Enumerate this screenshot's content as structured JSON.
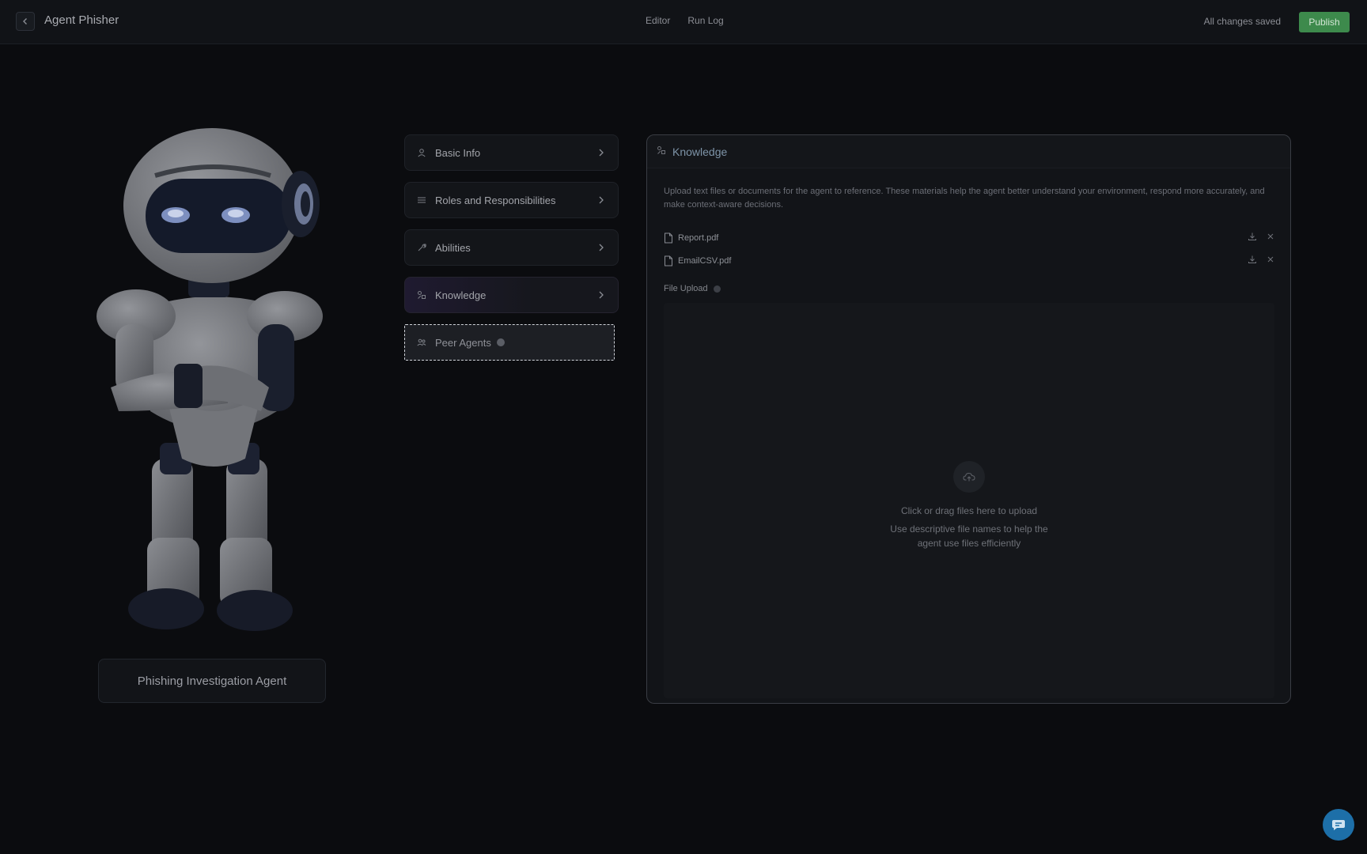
{
  "header": {
    "title": "Agent Phisher",
    "tabs": [
      "Editor",
      "Run Log"
    ],
    "status": "All changes saved",
    "publish_label": "Publish"
  },
  "agent": {
    "name": "Phishing Investigation Agent"
  },
  "nav": {
    "items": [
      {
        "label": "Basic Info",
        "icon": "user-icon"
      },
      {
        "label": "Roles and Responsibilities",
        "icon": "list-icon"
      },
      {
        "label": "Abilities",
        "icon": "tool-icon"
      },
      {
        "label": "Knowledge",
        "icon": "knowledge-icon",
        "active": true
      },
      {
        "label": "Peer Agents",
        "icon": "users-icon",
        "dragging": true
      }
    ]
  },
  "knowledge": {
    "title": "Knowledge",
    "description": "Upload text files or documents for the agent to reference. These materials help the agent better understand your environment, respond more accurately, and make context-aware decisions.",
    "files": [
      "Report.pdf",
      "EmailCSV.pdf"
    ],
    "upload_label": "File Upload",
    "drop_main": "Click or drag files here to upload",
    "drop_hint": "Use descriptive file names to help the agent use files efficiently"
  },
  "colors": {
    "accent_publish": "#3d8a4c",
    "chat_fab": "#1d6fa8"
  }
}
